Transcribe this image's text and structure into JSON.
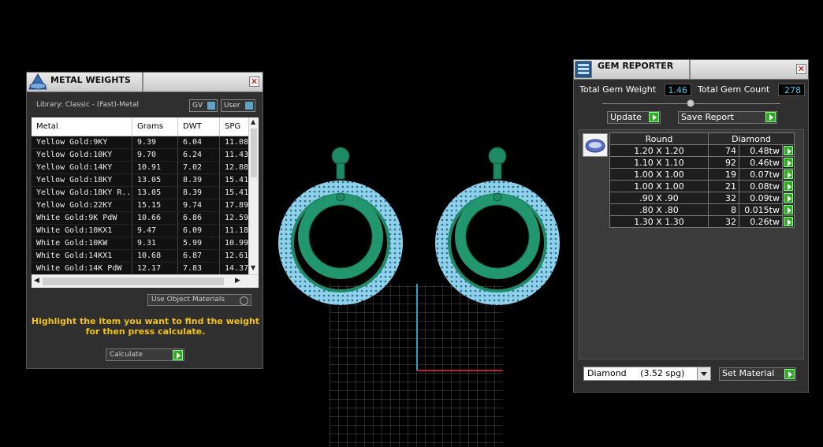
{
  "metal_weights": {
    "title": "METAL WEIGHTS",
    "library": "Library: Classic - (Fast)-Metal",
    "gv_label": "GV",
    "user_label": "User",
    "columns": [
      "Metal",
      "Grams",
      "DWT",
      "SPG"
    ],
    "rows": [
      [
        "Yellow Gold:9KY",
        "9.39",
        "6.04",
        "11.08"
      ],
      [
        "Yellow Gold:10KY",
        "9.70",
        "6.24",
        "11.43"
      ],
      [
        "Yellow Gold:14KY",
        "10.91",
        "7.02",
        "12.88"
      ],
      [
        "Yellow Gold:18KY",
        "13.05",
        "8.39",
        "15.41"
      ],
      [
        "Yellow Gold:18KY R...",
        "13.05",
        "8.39",
        "15.41"
      ],
      [
        "Yellow Gold:22KY",
        "15.15",
        "9.74",
        "17.89"
      ],
      [
        "White Gold:9K PdW",
        "10.66",
        "6.86",
        "12.59"
      ],
      [
        "White Gold:10KX1",
        "9.47",
        "6.09",
        "11.18"
      ],
      [
        "White Gold:10KW",
        "9.31",
        "5.99",
        "10.99"
      ],
      [
        "White Gold:14KX1",
        "10.68",
        "6.87",
        "12.61"
      ],
      [
        "White Gold:14K PdW",
        "12.17",
        "7.83",
        "14.37"
      ]
    ],
    "use_object_materials": "Use Object Materials",
    "hint_line1": "Highlight the item you want to find the weight",
    "hint_line2": "for then press calculate.",
    "calculate": "Calculate"
  },
  "gem_reporter": {
    "title": "GEM REPORTER",
    "total_weight_label": "Total Gem Weight",
    "total_weight_value": "1.46",
    "total_count_label": "Total Gem Count",
    "total_count_value": "278",
    "update": "Update",
    "save_report": "Save Report",
    "table_header": [
      "Round",
      "Diamond"
    ],
    "rows": [
      [
        "1.20 X 1.20",
        "74",
        "0.48tw"
      ],
      [
        "1.10 X 1.10",
        "92",
        "0.46tw"
      ],
      [
        "1.00 X 1.00",
        "19",
        "0.07tw"
      ],
      [
        "1.00 X 1.00",
        "21",
        "0.08tw"
      ],
      [
        ".90 X .90",
        "32",
        "0.09tw"
      ],
      [
        ".80 X .80",
        "8",
        "0.015tw"
      ],
      [
        "1.30 X 1.30",
        "32",
        "0.26tw"
      ]
    ],
    "material_select": "Diamond     (3.52 spg)",
    "set_material": "Set Material"
  },
  "colors": {
    "accent_green": "#35a82a",
    "value_cyan": "#49c7e4",
    "hint_yellow": "#f2c21a",
    "model_green": "#1f8a66",
    "gem_blue": "#7fc8e6"
  }
}
